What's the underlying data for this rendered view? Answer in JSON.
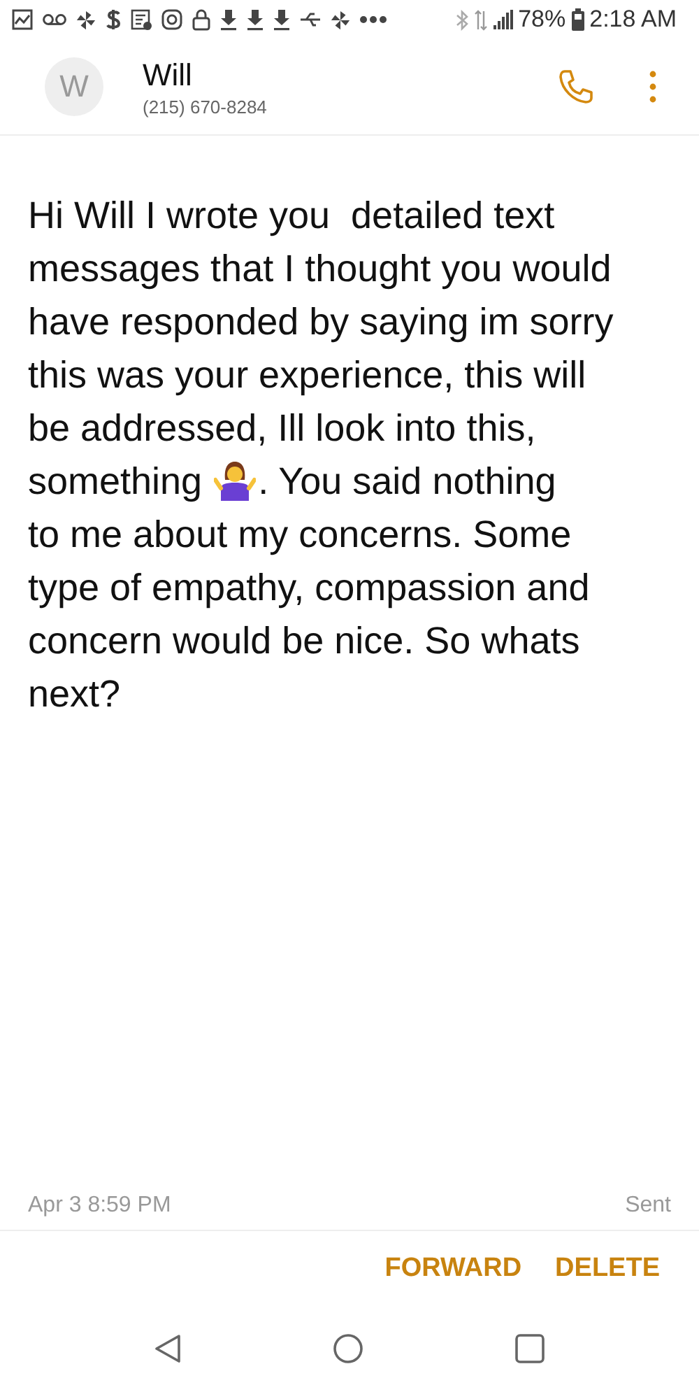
{
  "status_bar": {
    "battery": "78%",
    "time": "2:18 AM"
  },
  "header": {
    "avatar_letter": "W",
    "name": "Will",
    "phone": "(215) 670-8284"
  },
  "message": {
    "lines": [
      {
        "kind": "text",
        "text": "Hi Will I wrote you  detailed text"
      },
      {
        "kind": "text",
        "text": "messages that I thought you would"
      },
      {
        "kind": "text",
        "text": "have responded by saying im sorry"
      },
      {
        "kind": "text",
        "text": "this was your experience, this will"
      },
      {
        "kind": "text",
        "text": "be addressed, Ill look into this,"
      },
      {
        "kind": "emoji",
        "before": "something",
        "after": ". You said nothing"
      },
      {
        "kind": "text",
        "text": "to me about my concerns. Some"
      },
      {
        "kind": "text",
        "text": "type of empathy, compassion and"
      },
      {
        "kind": "text",
        "text": "concern would be nice. So whats"
      },
      {
        "kind": "text",
        "text": "next?"
      }
    ]
  },
  "footer": {
    "timestamp": "Apr 3 8:59 PM",
    "status": "Sent"
  },
  "actions": [
    "FORWARD",
    "DELETE"
  ]
}
